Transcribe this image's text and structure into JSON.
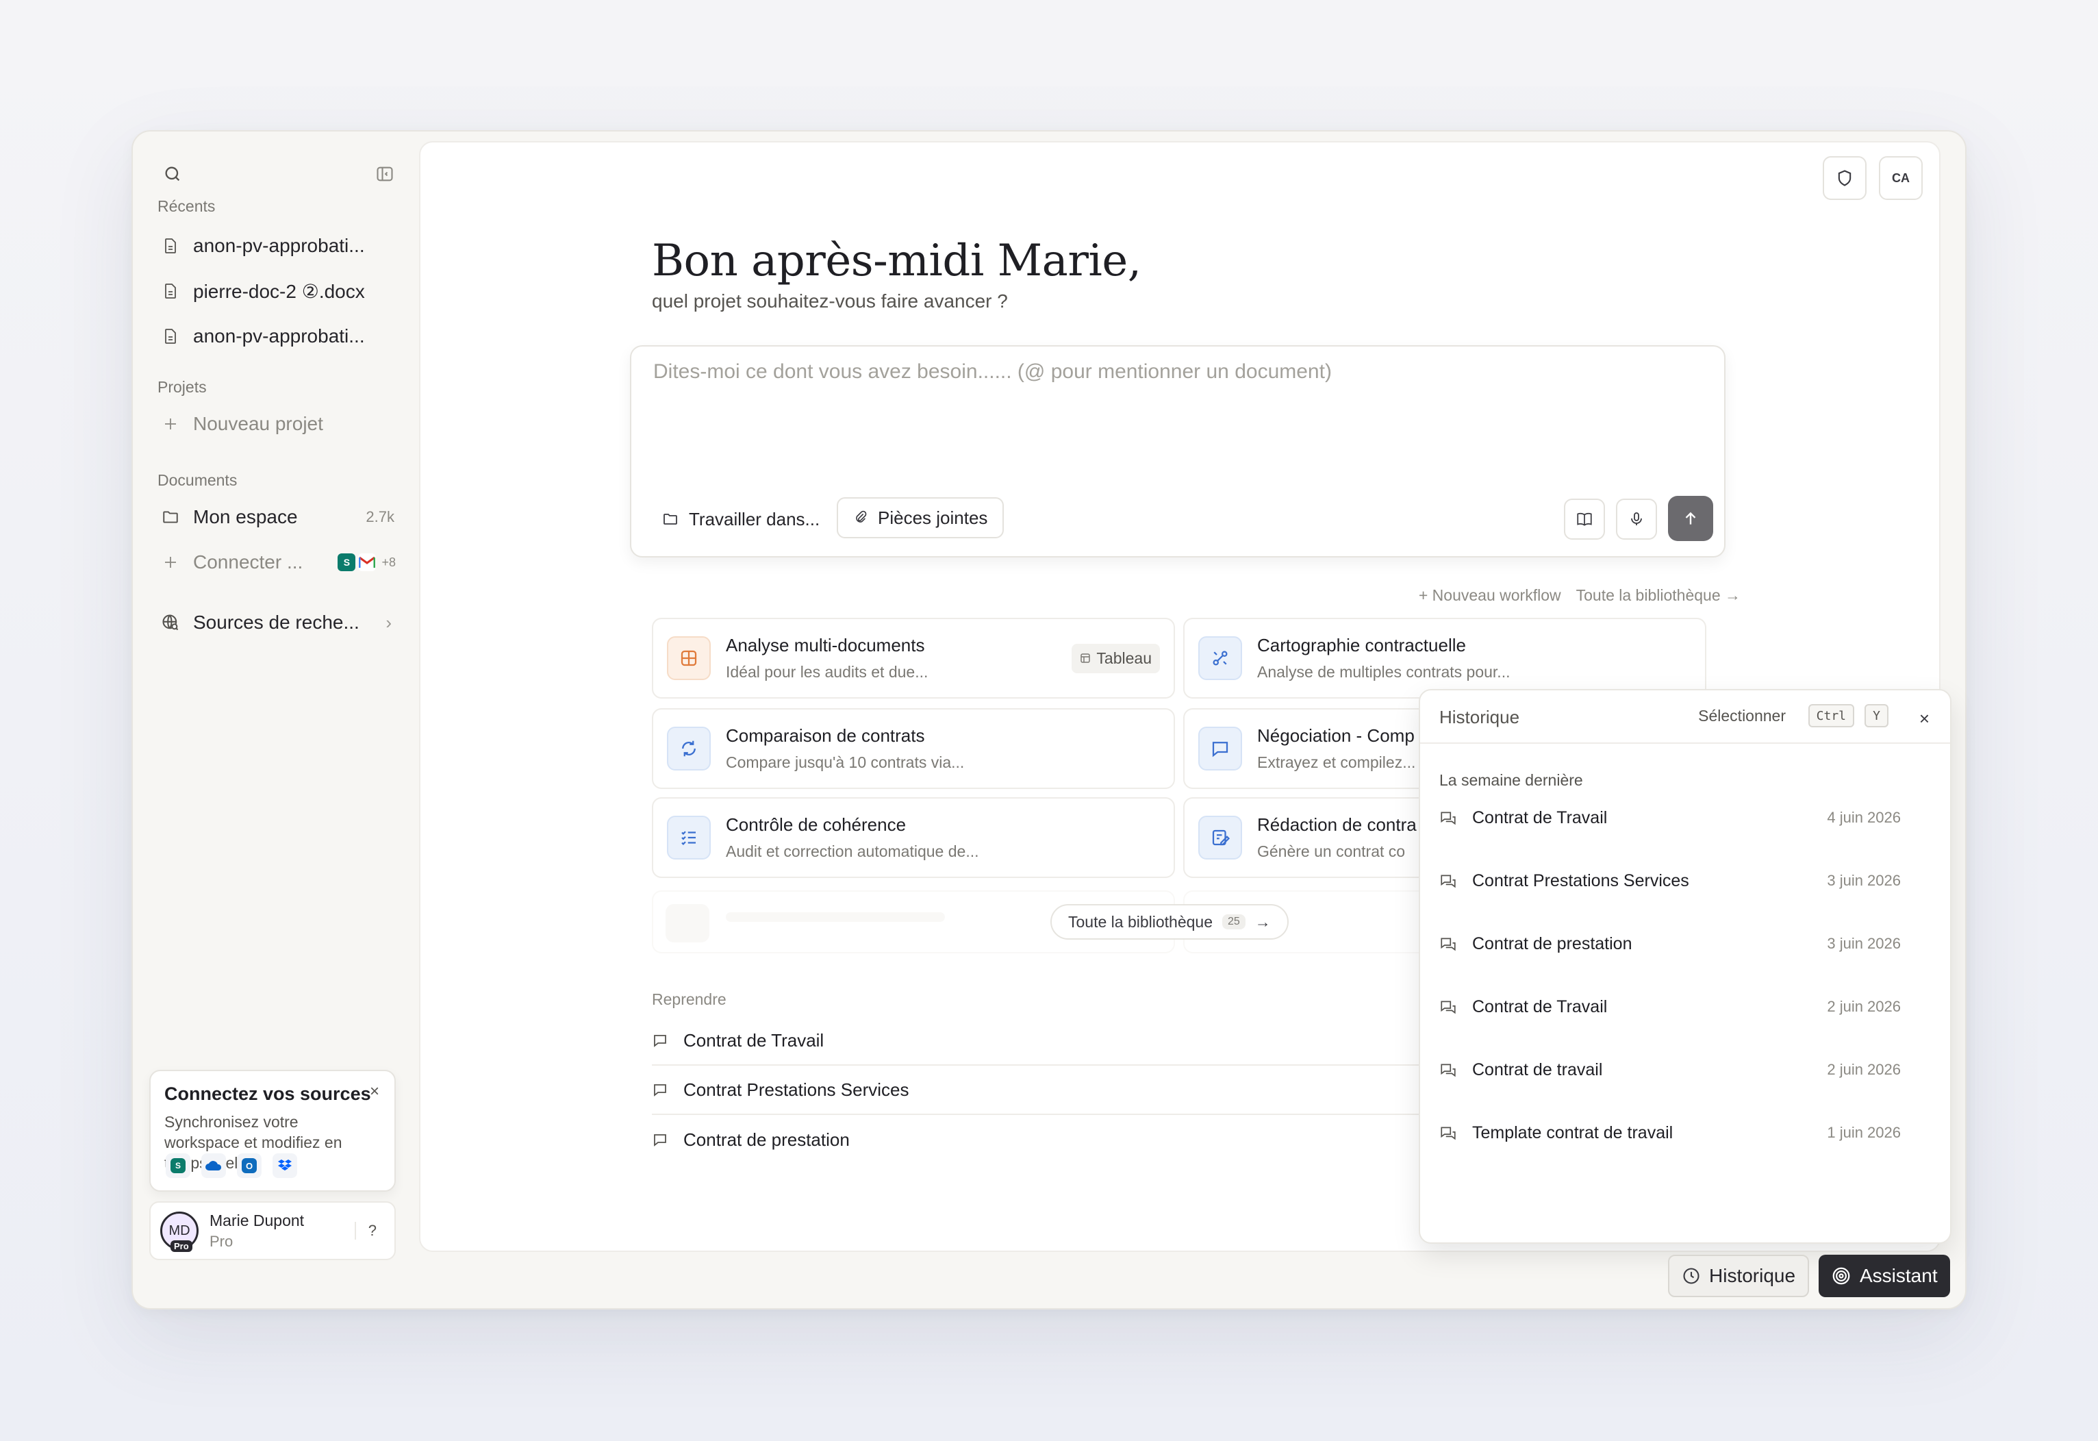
{
  "sidebar": {
    "recents_title": "Récents",
    "recents": [
      {
        "label": "anon-pv-approbati..."
      },
      {
        "label": "pierre-doc-2 ②.docx"
      },
      {
        "label": "anon-pv-approbati..."
      }
    ],
    "projects_title": "Projets",
    "new_project": "Nouveau projet",
    "documents_title": "Documents",
    "my_space": {
      "label": "Mon espace",
      "count": "2.7k"
    },
    "connect": {
      "label": "Connecter ...",
      "more": "+8"
    },
    "research_sources": "Sources de reche..."
  },
  "connect_card": {
    "title": "Connectez vos sources",
    "text": "Synchronisez votre workspace et modifiez en temps réel",
    "close": "×"
  },
  "user": {
    "initials": "MD",
    "badge": "Pro",
    "name": "Marie Dupont",
    "plan": "Pro",
    "help": "?"
  },
  "header": {
    "avatar_initials": "CA"
  },
  "greeting": {
    "title": "Bon après-midi Marie,",
    "subtitle": "quel projet souhaitez-vous faire avancer ?"
  },
  "composer": {
    "placeholder": "Dites-moi ce dont vous avez besoin...... (@ pour mentionner un document)",
    "work_in": "Travailler dans...",
    "attachments": "Pièces jointes"
  },
  "workflows": {
    "new_workflow": "+ Nouveau workflow",
    "library_link": "Toute la bibliothèque →",
    "cards": [
      {
        "title": "Analyse multi-documents",
        "desc": "Idéal pour les audits et due...",
        "tag": "Tableau"
      },
      {
        "title": "Cartographie contractuelle",
        "desc": "Analyse de multiples contrats pour..."
      },
      {
        "title": "Comparaison de contrats",
        "desc": "Compare jusqu'à 10 contrats via..."
      },
      {
        "title": "Négociation - Comp",
        "desc": "Extrayez et compilez..."
      },
      {
        "title": "Contrôle de cohérence",
        "desc": "Audit et correction automatique de..."
      },
      {
        "title": "Rédaction de contra",
        "desc": "Génère un contrat co"
      }
    ],
    "library_pill": {
      "label": "Toute la bibliothèque",
      "count": "25",
      "arrow": "→"
    }
  },
  "resume": {
    "title": "Reprendre",
    "items": [
      {
        "label": "Contrat de Travail"
      },
      {
        "label": "Contrat Prestations Services"
      },
      {
        "label": "Contrat de prestation"
      }
    ]
  },
  "history": {
    "title": "Historique",
    "select": "Sélectionner",
    "kbd1": "Ctrl",
    "kbd2": "Y",
    "close": "×",
    "group": "La semaine dernière",
    "items": [
      {
        "label": "Contrat de Travail",
        "date": "4 juin 2026"
      },
      {
        "label": "Contrat Prestations Services",
        "date": "3 juin 2026"
      },
      {
        "label": "Contrat de prestation",
        "date": "3 juin 2026"
      },
      {
        "label": "Contrat de Travail",
        "date": "2 juin 2026"
      },
      {
        "label": "Contrat de travail",
        "date": "2 juin 2026"
      },
      {
        "label": "Template contrat de travail",
        "date": "1 juin 2026"
      }
    ]
  },
  "bottom": {
    "history_btn": "Historique",
    "assistant_btn": "Assistant"
  },
  "colors": {
    "accent_orange": "#e07a3a",
    "accent_blue": "#3a6fd0",
    "send_button": "#6b6a6e"
  }
}
